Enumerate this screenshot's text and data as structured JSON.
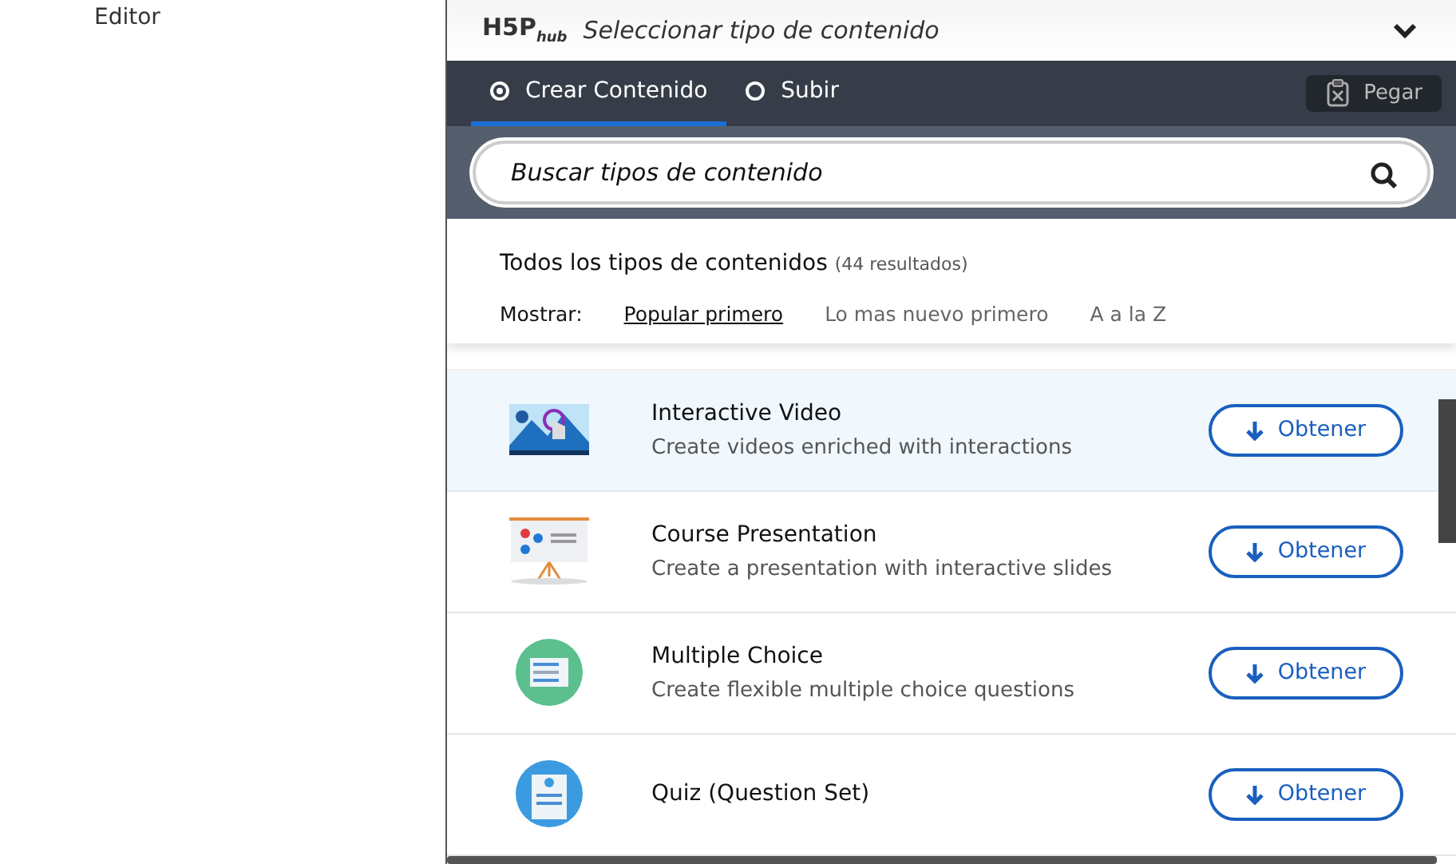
{
  "sidebar": {
    "label": "Editor"
  },
  "hub": {
    "logo": "H5P",
    "logo_suffix": "hub",
    "title": "Seleccionar tipo de contenido",
    "expanded": true
  },
  "tabs": [
    {
      "label": "Crear Contenido",
      "selected": true
    },
    {
      "label": "Subir",
      "selected": false
    }
  ],
  "paste_button": "Pegar",
  "search": {
    "placeholder": "Buscar tipos de contenido"
  },
  "results": {
    "heading": "Todos los tipos de contenidos",
    "count": "(44 resultados)"
  },
  "sort": {
    "label": "Mostrar:",
    "options": [
      {
        "label": "Popular primero",
        "selected": true
      },
      {
        "label": "Lo mas nuevo primero",
        "selected": false
      },
      {
        "label": "A a la Z",
        "selected": false
      }
    ]
  },
  "content_types": [
    {
      "kind": "video",
      "title": "Interactive Video",
      "description": "Create videos enriched with interactions",
      "button": "Obtener",
      "selected": true
    },
    {
      "kind": "presentation",
      "title": "Course Presentation",
      "description": "Create a presentation with interactive slides",
      "button": "Obtener",
      "selected": false
    },
    {
      "kind": "choice",
      "title": "Multiple Choice",
      "description": "Create flexible multiple choice questions",
      "button": "Obtener",
      "selected": false
    },
    {
      "kind": "quiz",
      "title": "Quiz (Question Set)",
      "button": "Obtener",
      "selected": false
    }
  ]
}
